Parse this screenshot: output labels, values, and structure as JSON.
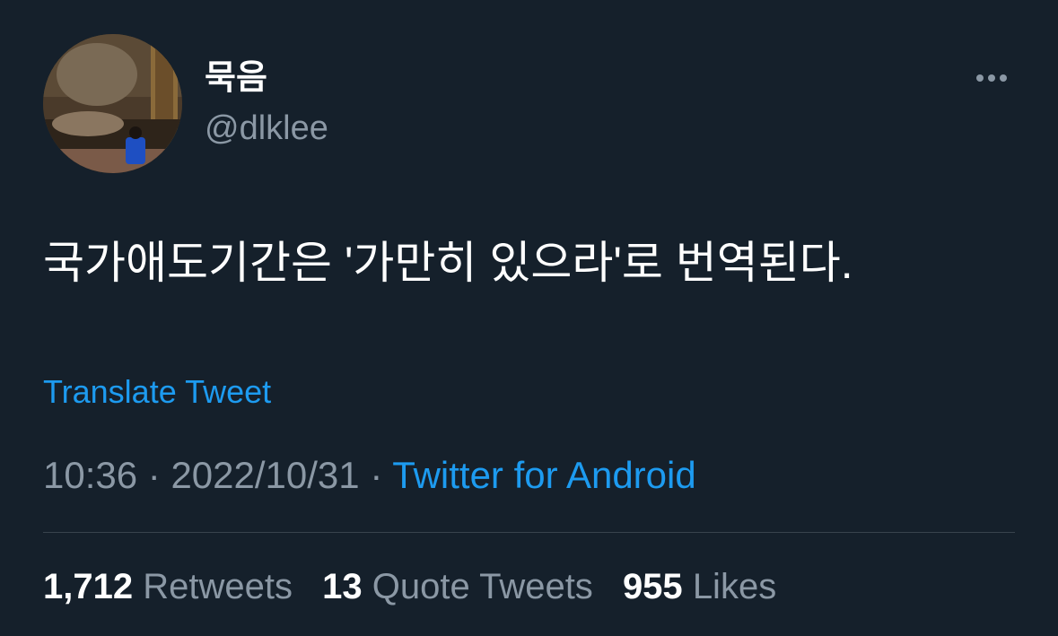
{
  "tweet": {
    "author": {
      "display_name": "묵음",
      "handle": "@dlklee"
    },
    "text": "국가애도기간은 '가만히 있으라'로 번역된다.",
    "translate_label": "Translate Tweet",
    "time": "10:36",
    "date": "2022/10/31",
    "separator": " · ",
    "source": "Twitter for Android",
    "stats": {
      "retweets_count": "1,712",
      "retweets_label": "Retweets",
      "quotes_count": "13",
      "quotes_label": "Quote Tweets",
      "likes_count": "955",
      "likes_label": "Likes"
    }
  },
  "colors": {
    "background": "#15202b",
    "primary_text": "#ffffff",
    "secondary_text": "#8b98a5",
    "accent": "#1d9bf0",
    "divider": "#38444d"
  },
  "icons": {
    "more": "more-horizontal-icon"
  }
}
